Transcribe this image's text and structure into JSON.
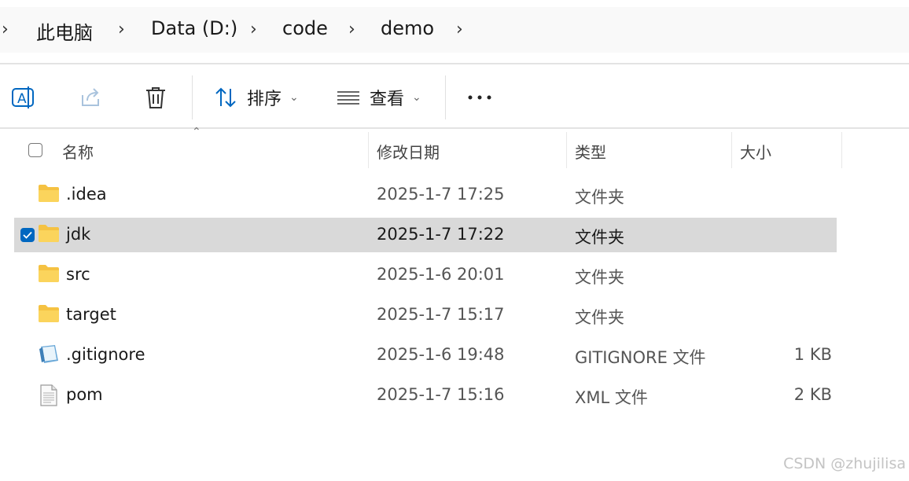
{
  "breadcrumb": {
    "items": [
      "此电脑",
      "Data (D:)",
      "code",
      "demo"
    ]
  },
  "toolbar": {
    "sort_label": "排序",
    "view_label": "查看"
  },
  "columns": {
    "name": "名称",
    "date": "修改日期",
    "type": "类型",
    "size": "大小"
  },
  "files": [
    {
      "name": ".idea",
      "date": "2025-1-7 17:25",
      "type": "文件夹",
      "size": "",
      "icon": "folder-icon",
      "selected": false
    },
    {
      "name": "jdk",
      "date": "2025-1-7 17:22",
      "type": "文件夹",
      "size": "",
      "icon": "folder-icon",
      "selected": true
    },
    {
      "name": "src",
      "date": "2025-1-6 20:01",
      "type": "文件夹",
      "size": "",
      "icon": "folder-icon",
      "selected": false
    },
    {
      "name": "target",
      "date": "2025-1-7 15:17",
      "type": "文件夹",
      "size": "",
      "icon": "folder-icon",
      "selected": false
    },
    {
      "name": ".gitignore",
      "date": "2025-1-6 19:48",
      "type": "GITIGNORE 文件",
      "size": "1 KB",
      "icon": "notepad-icon",
      "selected": false
    },
    {
      "name": "pom",
      "date": "2025-1-7 15:16",
      "type": "XML 文件",
      "size": "2 KB",
      "icon": "document-icon",
      "selected": false
    }
  ],
  "watermark": "CSDN @zhujilisa",
  "colors": {
    "accent": "#0067c0",
    "selection": "#d9d9d9",
    "folder": "#f5c242"
  }
}
